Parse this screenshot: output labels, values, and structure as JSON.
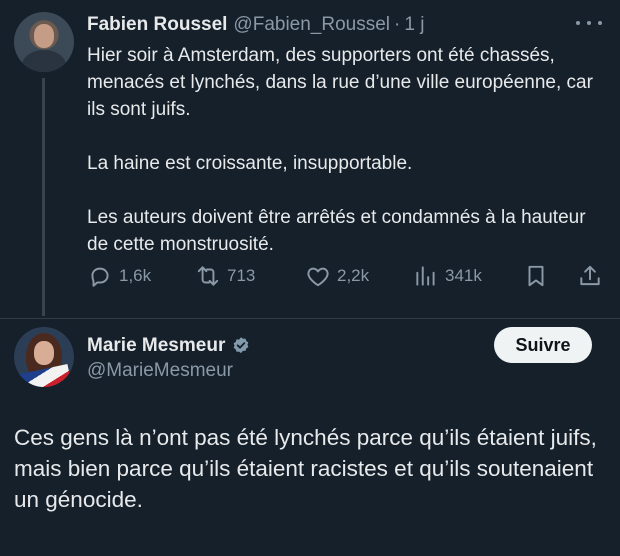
{
  "tweet1": {
    "author_name": "Fabien Roussel",
    "author_handle": "@Fabien_Roussel",
    "separator": "·",
    "time": "1 j",
    "paragraphs": [
      "Hier soir à Amsterdam, des supporters ont été chassés, menacés et lynchés, dans la rue d’une ville européenne, car ils sont juifs.",
      "La haine est croissante, insupportable.",
      "Les auteurs doivent être arrêtés et condamnés à la hauteur de cette monstruosité."
    ],
    "actions": {
      "replies": "1,6k",
      "reposts": "713",
      "likes": "2,2k",
      "views": "341k"
    },
    "icons": [
      "more-icon",
      "reply-icon",
      "repost-icon",
      "like-icon",
      "views-icon",
      "bookmark-icon",
      "share-icon"
    ]
  },
  "tweet2": {
    "author_name": "Marie Mesmeur",
    "author_handle": "@MarieMesmeur",
    "follow_label": "Suivre",
    "verified": true,
    "text": "Ces gens là n’ont pas été lynchés parce qu’ils étaient juifs, mais bien parce qu’ils étaient racistes et qu’ils soutenaient un génocide.",
    "icons": [
      "verified-badge-icon"
    ]
  },
  "colors": {
    "background": "#15202b",
    "text": "#e7e9ea",
    "muted": "#8b98a5",
    "verified_badge": "#829aab",
    "follow_button_bg": "#eff3f4"
  }
}
